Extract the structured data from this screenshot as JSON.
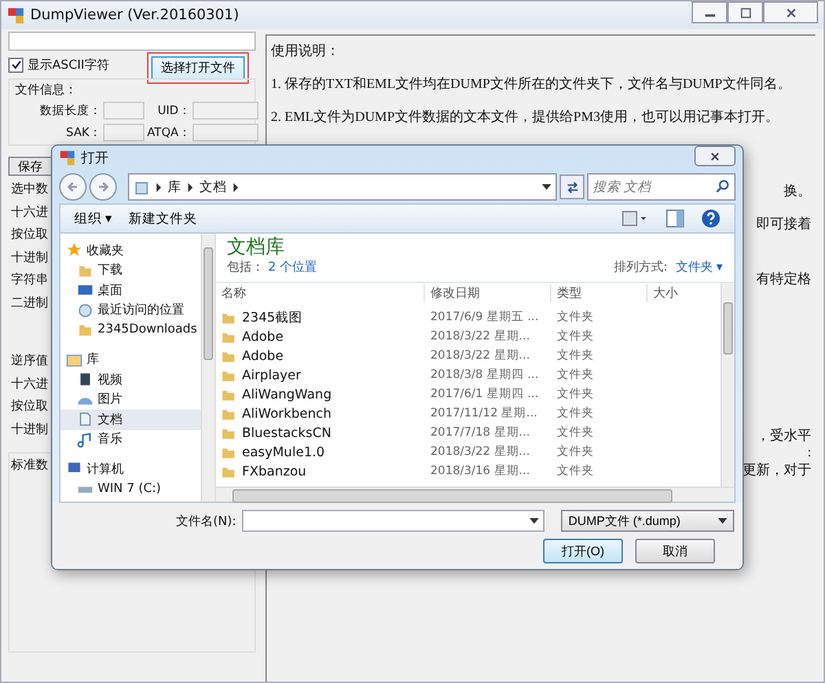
{
  "window": {
    "title": "DumpViewer (Ver.20160301)"
  },
  "left_panel": {
    "ascii_checkbox": {
      "label": "显示ASCII字符",
      "checked": true
    },
    "open_button": {
      "label": "选择打开文件",
      "highlighted": true
    },
    "file_info": {
      "title": "文件信息：",
      "fields": [
        {
          "label": "数据长度："
        },
        {
          "label": "UID："
        },
        {
          "label": "SAK："
        },
        {
          "label": "ATQA："
        }
      ]
    },
    "save_button": {
      "label": "保存"
    },
    "labels": [
      "选中数",
      "十六进",
      "按位取",
      "十进制",
      "字符串",
      "二进制",
      "逆序值",
      "十六进",
      "按位取",
      "十进制"
    ],
    "standard_label": "标准数"
  },
  "instructions": {
    "lines": [
      "使用说明：",
      "1. 保存的TXT和EML文件均在DUMP文件所在的文件夹下，文件名与DUMP文件同名。",
      "2. EML文件为DUMP文件数据的文本文件，提供给PM3使用，也可以用记事本打开。",
      "换。",
      "即可接着",
      "有特定格",
      "，受水平",
      ":",
      "更新，对于"
    ]
  },
  "dialog": {
    "title": "打开",
    "breadcrumb": [
      "库",
      "文档"
    ],
    "search": {
      "placeholder": "搜索 文档"
    },
    "toolbar": [
      "组织 ▾",
      "新建文件夹"
    ],
    "nav_tree": [
      {
        "label": "收藏夹",
        "selected": false,
        "children": [
          {
            "label": "下载",
            "selected": false
          },
          {
            "label": "桌面",
            "selected": false
          },
          {
            "label": "最近访问的位置",
            "selected": false
          },
          {
            "label": "2345Downloads",
            "selected": false
          }
        ]
      },
      {
        "label": "库",
        "selected": false,
        "children": [
          {
            "label": "视频",
            "selected": false
          },
          {
            "label": "图片",
            "selected": false
          },
          {
            "label": "文档",
            "selected": true
          },
          {
            "label": "音乐",
            "selected": false
          }
        ]
      },
      {
        "label": "计算机",
        "selected": false,
        "children": [
          {
            "label": "WIN 7 (C:)",
            "selected": false
          }
        ]
      }
    ],
    "library_title": "文档库",
    "includes_label": "包括：",
    "includes_link": "2 个位置",
    "arrange_label": "排列方式:",
    "arrange_value": "文件夹 ▾",
    "columns": [
      "名称",
      "修改日期",
      "类型",
      "大小"
    ],
    "rows": [
      [
        "2345截图",
        "2017/6/9 星期五 ...",
        "文件夹"
      ],
      [
        "Adobe",
        "2018/3/22 星期...",
        "文件夹"
      ],
      [
        "Adobe",
        "2018/3/22 星期...",
        "文件夹"
      ],
      [
        "Airplayer",
        "2018/3/8 星期四 ...",
        "文件夹"
      ],
      [
        "AliWangWang",
        "2017/6/1 星期四 ...",
        "文件夹"
      ],
      [
        "AliWorkbench",
        "2017/11/12 星期...",
        "文件夹"
      ],
      [
        "BluestacksCN",
        "2017/7/18 星期...",
        "文件夹"
      ],
      [
        "easyMule1.0",
        "2018/3/22 星期...",
        "文件夹"
      ],
      [
        "FXbanzou",
        "2018/3/16 星期...",
        "文件夹"
      ]
    ],
    "filename_label": "文件名(N):",
    "filetype": "DUMP文件 (*.dump)",
    "buttons": [
      "打开(O)",
      "取消"
    ]
  }
}
